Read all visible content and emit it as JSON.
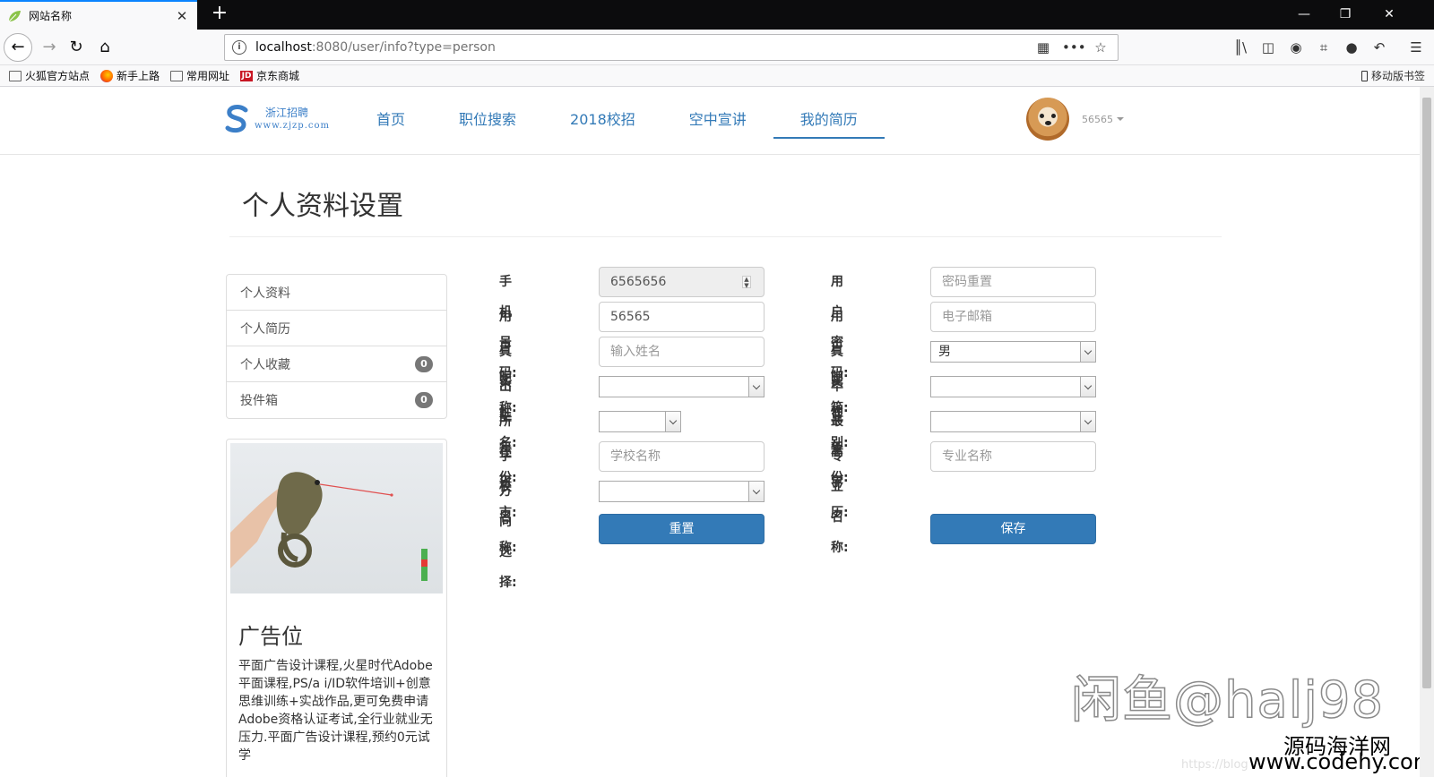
{
  "browser": {
    "tab_title": "网站名称",
    "tab_close": "✕",
    "new_tab": "+",
    "url_host": "localhost",
    "url_rest": ":8080/user/info?type=person",
    "bookmarks": [
      "火狐官方站点",
      "新手上路",
      "常用网址",
      "京东商城"
    ],
    "mobile_bookmarks": "移动版书签",
    "icons": [
      "back-icon",
      "forward-icon",
      "reload-icon",
      "home-icon",
      "qr-code-icon",
      "more-icon",
      "star-icon",
      "library-icon",
      "sidebar-icon",
      "sync-icon",
      "screenshot-icon",
      "chat-icon",
      "undo-icon",
      "menu-icon"
    ]
  },
  "site": {
    "logo_cn": "浙江招聘",
    "logo_en": "www.zjzp.com",
    "nav": [
      "首页",
      "职位搜索",
      "2018校招",
      "空中宣讲",
      "我的简历"
    ],
    "active_nav": "我的简历",
    "username": "56565",
    "accent": "#337ab7"
  },
  "page": {
    "title": "个人资料设置"
  },
  "side_menu": [
    {
      "label": "个人资料",
      "badge": ""
    },
    {
      "label": "个人简历",
      "badge": ""
    },
    {
      "label": "个人收藏",
      "badge": "0"
    },
    {
      "label": "投件箱",
      "badge": "0"
    }
  ],
  "ad": {
    "title": "广告位",
    "text": "平面广告设计课程,火星时代Adobe平面课程,PS/a i/ID软件培训+创意思维训练+实战作品,更可免费申请Adobe资格认证考试,全行业就业无压力.平面广告设计课程,预约0元试学"
  },
  "form": {
    "phone": {
      "label": "手机号码:",
      "value": "6565656"
    },
    "nickname": {
      "label": "用户昵称:",
      "value": "56565"
    },
    "realname": {
      "label": "真实姓名:",
      "placeholder": "输入姓名"
    },
    "birth_year": {
      "label": "出生年份:",
      "value": ""
    },
    "province_city": {
      "label": "所在省市:",
      "value": ""
    },
    "school": {
      "label": "学校名称:",
      "placeholder": "学校名称"
    },
    "direction": {
      "label": "方向选择:",
      "value": ""
    },
    "password": {
      "label": "用户密码:",
      "placeholder": "密码重置"
    },
    "email": {
      "label": "用户邮箱:",
      "placeholder": "电子邮箱"
    },
    "gender": {
      "label": "真实性别:",
      "value": "男"
    },
    "grad_year": {
      "label": "毕业年份:",
      "value": ""
    },
    "education": {
      "label": "最高学历:",
      "value": ""
    },
    "major": {
      "label": "专业名称:",
      "placeholder": "专业名称"
    },
    "reset_label": "重置",
    "save_label": "保存"
  },
  "watermark": {
    "main": "闲鱼@halj98",
    "site_cn": "源码海洋网",
    "site_url": "www.codehy.com",
    "faint": "https://blog"
  }
}
